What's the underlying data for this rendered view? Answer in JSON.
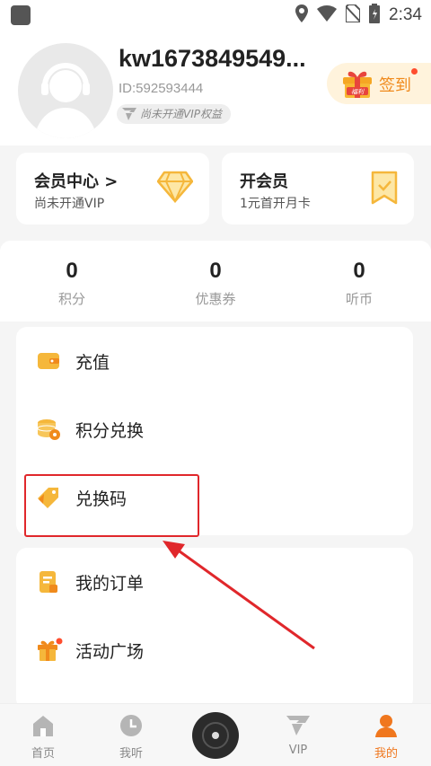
{
  "status_bar": {
    "time": "2:34"
  },
  "profile": {
    "username": "kw1673849549...",
    "user_id": "ID:592593444",
    "vip_status": "尚未开通VIP权益",
    "signin_label": "签到",
    "signin_gift_text": "福利"
  },
  "member_center": {
    "title": "会员中心 >",
    "subtitle": "尚未开通VIP"
  },
  "open_member": {
    "title": "开会员",
    "subtitle": "1元首开月卡"
  },
  "stats": [
    {
      "value": "0",
      "label": "积分"
    },
    {
      "value": "0",
      "label": "优惠券"
    },
    {
      "value": "0",
      "label": "听币"
    }
  ],
  "menu_section_1": [
    {
      "label": "充值",
      "icon": "wallet-icon"
    },
    {
      "label": "积分兑换",
      "icon": "coins-icon"
    },
    {
      "label": "兑换码",
      "icon": "tag-icon"
    }
  ],
  "menu_section_2": [
    {
      "label": "我的订单",
      "icon": "order-icon"
    },
    {
      "label": "活动广场",
      "icon": "gift-icon"
    }
  ],
  "tabbar": [
    {
      "label": "首页",
      "icon": "home-icon"
    },
    {
      "label": "我听",
      "icon": "clock-icon"
    },
    {
      "label": "VIP",
      "icon": "vip-icon"
    },
    {
      "label": "我的",
      "icon": "profile-icon"
    }
  ],
  "colors": {
    "accent": "#f0771e",
    "highlight": "#e0272b",
    "gold": "#f5b73b"
  }
}
